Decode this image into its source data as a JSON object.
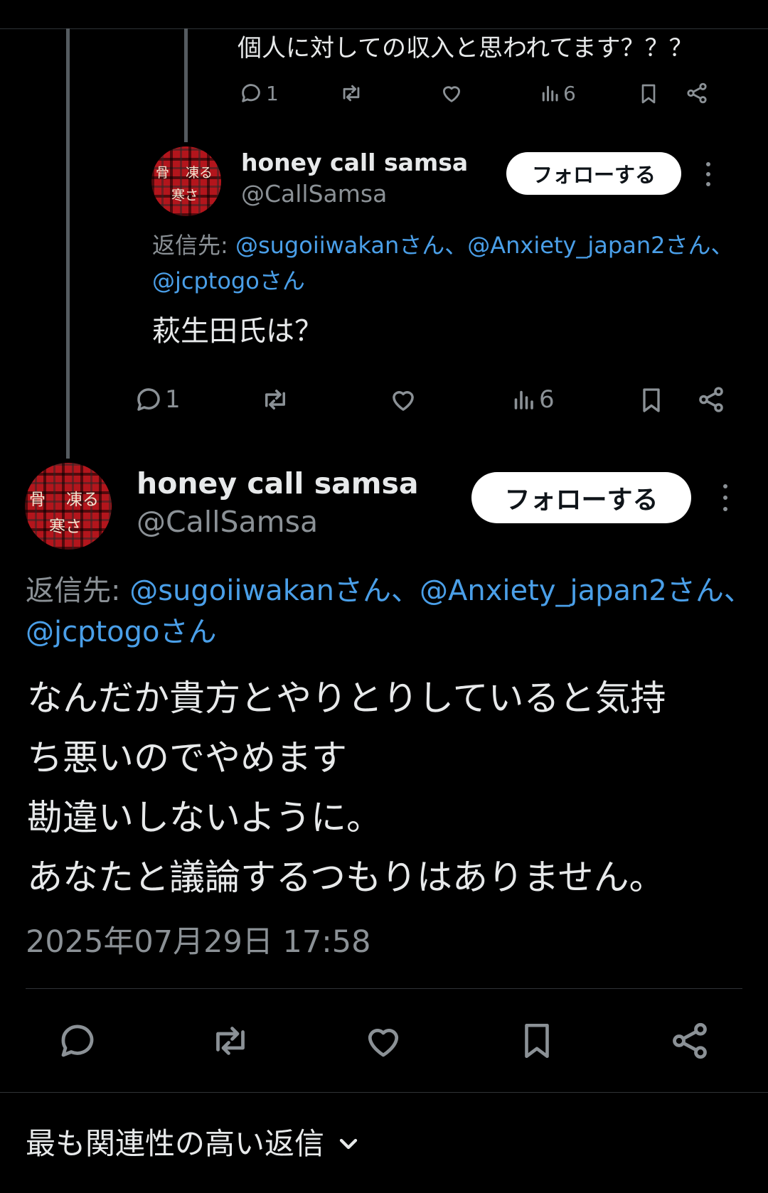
{
  "tweet1": {
    "text": "個人に対しての収入と思われてます？？？",
    "reply_count": "1",
    "view_count": "6"
  },
  "tweet2": {
    "avatar_lines": [
      "骨",
      "凍る",
      "寒さ"
    ],
    "display_name": "honey call samsa",
    "handle": "@CallSamsa",
    "follow_label": "フォローする",
    "reply_prefix": "返信先: ",
    "reply_to_line1": "@sugoiiwakanさん、@Anxiety_japan2さん、",
    "reply_to_line2": "@jcptogoさん",
    "text": "萩生田氏は？",
    "reply_count": "1",
    "view_count": "6"
  },
  "main_tweet": {
    "avatar_lines": [
      "骨",
      "凍る",
      "寒さ"
    ],
    "display_name": "honey call samsa",
    "handle": "@CallSamsa",
    "follow_label": "フォローする",
    "reply_prefix": "返信先: ",
    "reply_to_line1": "@sugoiiwakanさん、@Anxiety_japan2さん、",
    "reply_to_line2": "@jcptogoさん",
    "text_lines": [
      "なんだか貴方とやりとりしていると気持",
      "ち悪いのでやめます",
      "勘違いしないように。",
      "あなたと議論するつもりはありません。"
    ],
    "timestamp": "2025年07月29日 17:58"
  },
  "replies_sort": {
    "label": "最も関連性の高い返信"
  },
  "icons": [
    "reply-icon",
    "retweet-icon",
    "like-icon",
    "views-icon",
    "bookmark-icon",
    "share-icon",
    "more-icon",
    "chevron-down-icon"
  ],
  "colors": {
    "background": "#000000",
    "link": "#4a9fe8",
    "secondary_text": "#8b9196",
    "avatar_red": "#b3151c"
  }
}
